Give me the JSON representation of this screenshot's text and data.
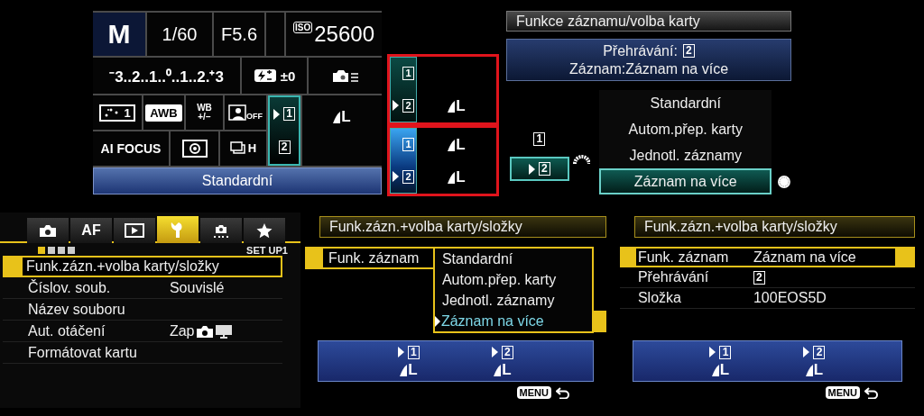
{
  "quick_control": {
    "mode": "M",
    "shutter": "1/60",
    "aperture": "F5.6",
    "iso_label": "ISO",
    "iso": "25600",
    "exposure_scale": "⁻3..2..1..⁰..1..2.⁺3",
    "flash_comp": "±0",
    "picture_style": "1",
    "white_balance": "AWB",
    "wb_shift": [
      "WB",
      "+/−"
    ],
    "alo": "OFF",
    "af_mode": "AI FOCUS",
    "drive": "H",
    "cards": [
      {
        "label": "1",
        "selected": true,
        "quality": "L"
      },
      {
        "label": "2",
        "selected": false
      }
    ],
    "style_name": "Standardní"
  },
  "card_setups": [
    {
      "kind": "teal",
      "cards": [
        {
          "label": "1",
          "selected": false
        },
        {
          "label": "2",
          "selected": true,
          "quality": "L"
        }
      ]
    },
    {
      "kind": "blue",
      "cards": [
        {
          "label": "1",
          "selected": false,
          "quality": "L"
        },
        {
          "label": "2",
          "selected": true,
          "quality": "L"
        }
      ]
    }
  ],
  "record_dialog": {
    "title": "Funkce záznamu/volba karty",
    "playback_label": "Přehrávání:",
    "playback_card": "2",
    "record_line": "Záznam:Záznam na více",
    "cards": [
      {
        "label": "1",
        "selected": false
      },
      {
        "label": "2",
        "selected": true
      }
    ],
    "options": [
      {
        "label": "Standardní",
        "selected": false
      },
      {
        "label": "Autom.přep. karty",
        "selected": false
      },
      {
        "label": "Jednotl. záznamy",
        "selected": false
      },
      {
        "label": "Záznam na více",
        "selected": true
      }
    ]
  },
  "setup_menu": {
    "tabs": [
      {
        "kind": "camera",
        "selected": false
      },
      {
        "kind": "text",
        "label": "AF",
        "selected": false
      },
      {
        "kind": "play",
        "selected": false
      },
      {
        "kind": "wrench",
        "selected": true
      },
      {
        "kind": "custom",
        "selected": false
      },
      {
        "kind": "star",
        "selected": false
      }
    ],
    "pages": [
      {
        "selected": true
      },
      {
        "selected": false
      },
      {
        "selected": false
      },
      {
        "selected": false
      }
    ],
    "page_label": "SET UP1",
    "items": [
      {
        "kind": "text",
        "label": "Funk.zázn.+volba karty/složky",
        "selected": true
      },
      {
        "kind": "text",
        "label": "Číslov. soub.",
        "value": "Souvislé",
        "selected": false
      },
      {
        "kind": "text",
        "label": "Název souboru",
        "selected": false
      },
      {
        "kind": "text_icons",
        "label": "Aut. otáčení",
        "value": "Zap",
        "selected": false
      },
      {
        "kind": "text",
        "label": "Formátovat kartu",
        "selected": false
      }
    ]
  },
  "record_menu_open": {
    "title": "Funk.zázn.+volba karty/složky",
    "setting": "Funk. záznam",
    "options": [
      {
        "label": "Standardní",
        "selected": false
      },
      {
        "label": "Autom.přep. karty",
        "selected": false
      },
      {
        "label": "Jednotl. záznamy",
        "selected": false
      },
      {
        "label": "Záznam na více",
        "selected": true
      }
    ],
    "cards": [
      {
        "label": "1",
        "selected": true,
        "quality": "L"
      },
      {
        "label": "2",
        "selected": true,
        "quality": "L"
      }
    ],
    "back": "MENU"
  },
  "record_menu": {
    "title": "Funk.zázn.+volba karty/složky",
    "rows": [
      {
        "label": "Funk. záznam",
        "value": "Záznam na více",
        "selected": true
      },
      {
        "label": "Přehrávání",
        "card": "2",
        "selected": false
      },
      {
        "label": "Složka",
        "value": "100EOS5D",
        "selected": false
      }
    ],
    "cards": [
      {
        "label": "1",
        "selected": true,
        "quality": "L"
      },
      {
        "label": "2",
        "selected": true,
        "quality": "L"
      }
    ],
    "back": "MENU"
  }
}
